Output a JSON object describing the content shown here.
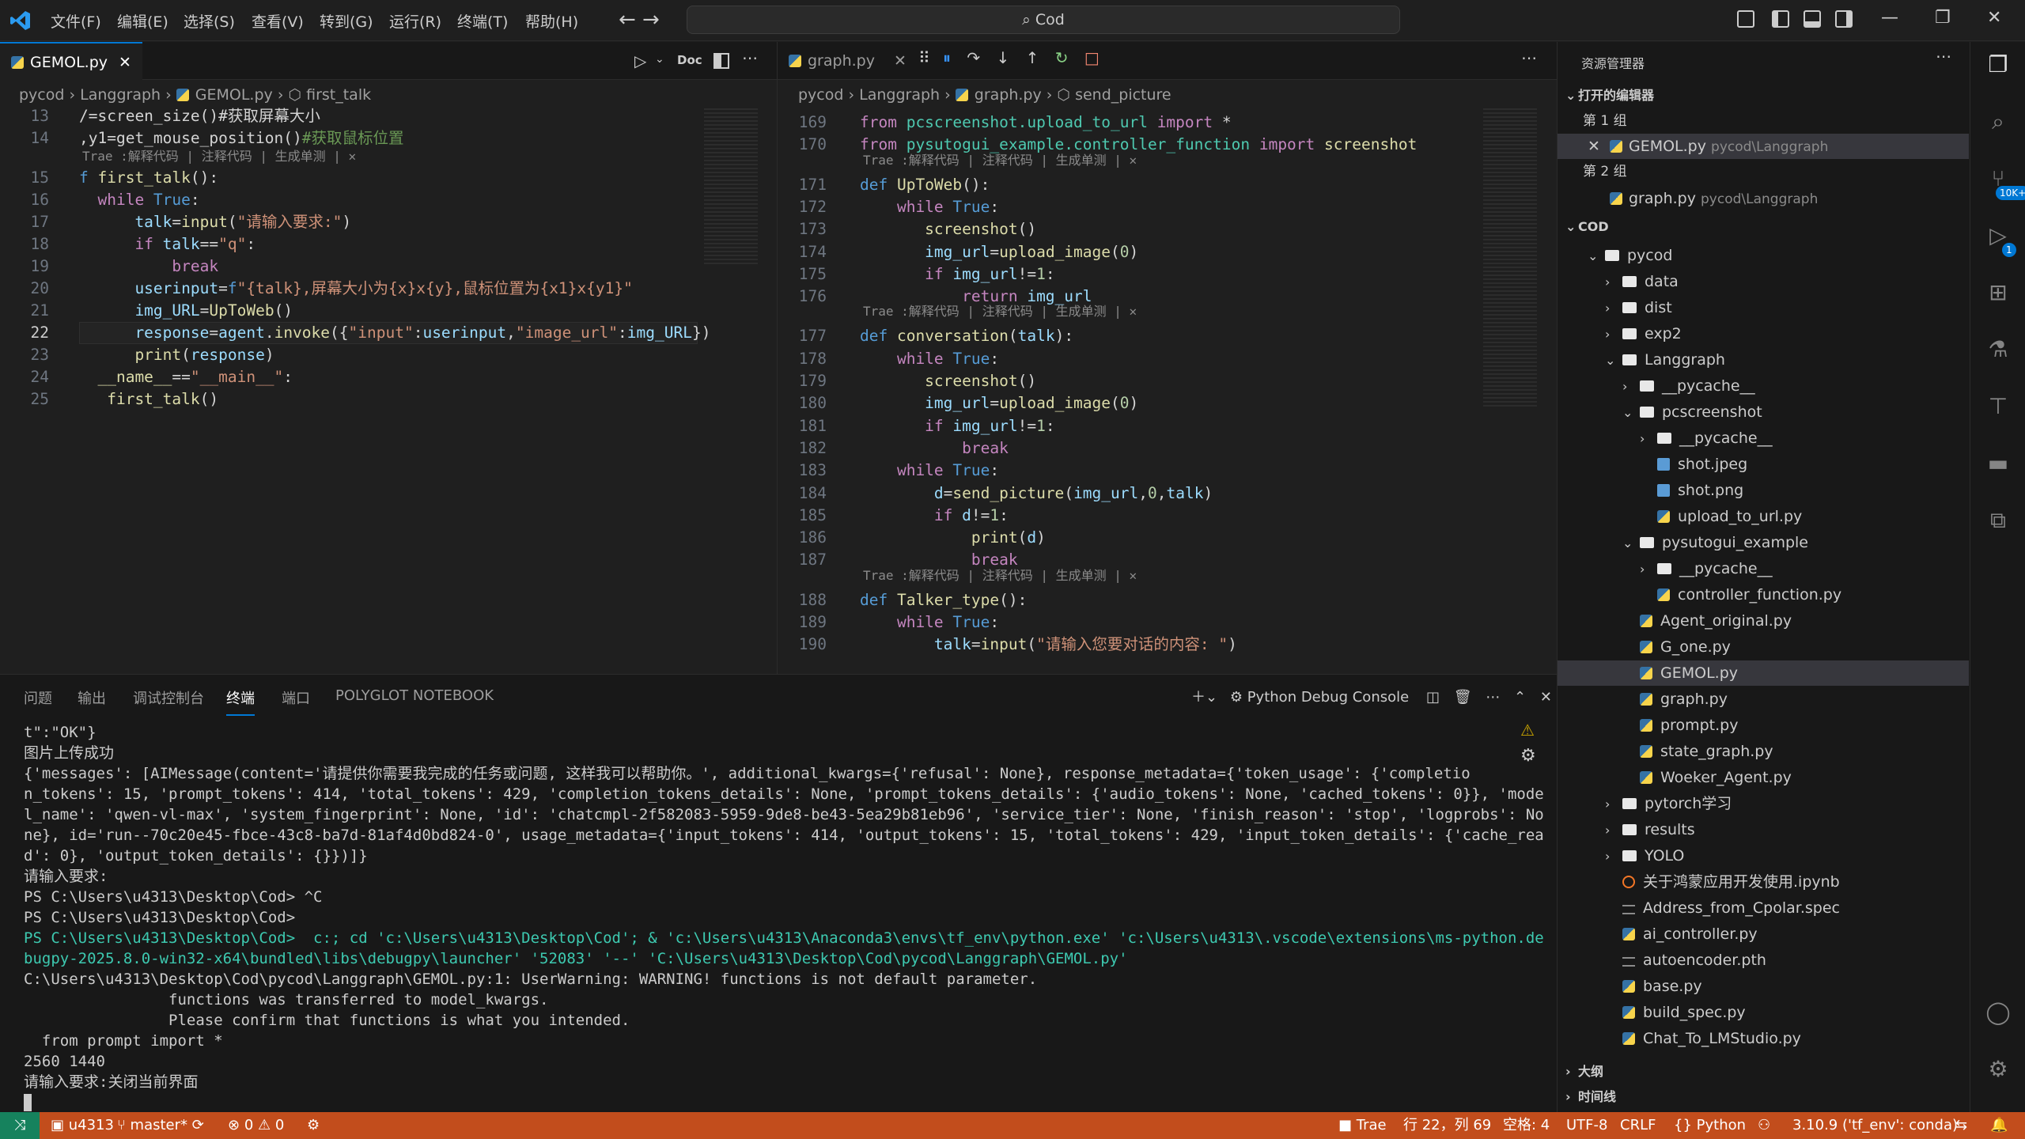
{
  "titlebar": {
    "menus": [
      "文件(F)",
      "编辑(E)",
      "选择(S)",
      "查看(V)",
      "转到(G)",
      "运行(R)",
      "终端(T)",
      "帮助(H)"
    ],
    "search": "Cod",
    "nav": "← →"
  },
  "left_editor": {
    "tab": "GEMOL.py",
    "toolbar": {
      "doc": "Doc"
    },
    "breadcrumb": [
      "pycod",
      "Langgraph",
      "GEMOL.py",
      "first_talk"
    ],
    "lines": [
      {
        "n": "13",
        "parts": [
          [
            "pl",
            "/=screen_size()#获取屏幕大小"
          ]
        ]
      },
      {
        "n": "14",
        "parts": [
          [
            "pl",
            ",y1=get_mouse_position()"
          ],
          [
            "cm",
            "#获取鼠标位置"
          ]
        ]
      },
      {
        "n": "15",
        "parts": [
          [
            "kwb",
            "f "
          ],
          [
            "fn",
            "first_talk"
          ],
          [
            "pl",
            "():"
          ]
        ]
      },
      {
        "n": "16",
        "parts": [
          [
            "kw",
            "  while "
          ],
          [
            "kwb",
            "True"
          ],
          [
            "pl",
            ":"
          ]
        ]
      },
      {
        "n": "17",
        "parts": [
          [
            "nv",
            "      talk"
          ],
          [
            "pl",
            "="
          ],
          [
            "fn",
            "input"
          ],
          [
            "pl",
            "("
          ],
          [
            "st",
            "\"请输入要求:\""
          ],
          [
            "pl",
            ")"
          ]
        ]
      },
      {
        "n": "18",
        "parts": [
          [
            "kw",
            "      if "
          ],
          [
            "nv",
            "talk"
          ],
          [
            "pl",
            "=="
          ],
          [
            "st",
            "\"q\""
          ],
          [
            "pl",
            ":"
          ]
        ]
      },
      {
        "n": "19",
        "parts": [
          [
            "kw",
            "          break"
          ]
        ]
      },
      {
        "n": "20",
        "parts": [
          [
            "nv",
            "      userinput"
          ],
          [
            "pl",
            "="
          ],
          [
            "kwb",
            "f"
          ],
          [
            "st",
            "\"{talk},屏幕大小为{x}x{y},鼠标位置为{x1}x{y1}\""
          ]
        ]
      },
      {
        "n": "21",
        "parts": [
          [
            "nv",
            "      img_URL"
          ],
          [
            "pl",
            "="
          ],
          [
            "fn",
            "UpToWeb"
          ],
          [
            "pl",
            "()"
          ]
        ]
      },
      {
        "n": "22",
        "parts": [
          [
            "nv",
            "      response"
          ],
          [
            "pl",
            "="
          ],
          [
            "nv",
            "agent"
          ],
          [
            "pl",
            "."
          ],
          [
            "fn",
            "invoke"
          ],
          [
            "pl",
            "({"
          ],
          [
            "st",
            "\"input\""
          ],
          [
            "pl",
            ":"
          ],
          [
            "nv",
            "userinput"
          ],
          [
            "pl",
            ","
          ],
          [
            "st",
            "\"image_url\""
          ],
          [
            "pl",
            ":"
          ],
          [
            "nv",
            "img_URL"
          ],
          [
            "pl",
            "})"
          ]
        ]
      },
      {
        "n": "23",
        "parts": [
          [
            "fn",
            "      print"
          ],
          [
            "pl",
            "("
          ],
          [
            "nv",
            "response"
          ],
          [
            "pl",
            ")"
          ]
        ]
      },
      {
        "n": "24",
        "parts": [
          [
            "pl",
            "  "
          ],
          [
            "fn",
            "__name__"
          ],
          [
            "pl",
            "=="
          ],
          [
            "st",
            "\"__main__\""
          ],
          [
            "pl",
            ":"
          ]
        ]
      },
      {
        "n": "25",
        "parts": [
          [
            "fn",
            "   first_talk"
          ],
          [
            "pl",
            "()"
          ]
        ]
      }
    ],
    "hint": "Trae :解释代码 | 注释代码 | 生成单测 | ✕"
  },
  "right_editor": {
    "tab": "graph.py",
    "breadcrumb": [
      "pycod",
      "Langgraph",
      "graph.py",
      "send_picture"
    ],
    "hint": "Trae :解释代码 | 注释代码 | 生成单测 | ✕",
    "lines": [
      {
        "n": "169",
        "parts": [
          [
            "kw",
            "from "
          ],
          [
            "cl",
            "pcscreenshot.upload_to_url"
          ],
          [
            "kw",
            " import "
          ],
          [
            "pl",
            "*"
          ]
        ]
      },
      {
        "n": "170",
        "parts": [
          [
            "kw",
            "from "
          ],
          [
            "cl",
            "pysutogui_example.controller_function"
          ],
          [
            "kw",
            " import "
          ],
          [
            "fn",
            "screenshot"
          ]
        ]
      },
      {
        "n": "171",
        "parts": [
          [
            "kwb",
            "def "
          ],
          [
            "fn",
            "UpToWeb"
          ],
          [
            "pl",
            "():"
          ]
        ]
      },
      {
        "n": "172",
        "parts": [
          [
            "kw",
            "    while "
          ],
          [
            "kwb",
            "True"
          ],
          [
            "pl",
            ":"
          ]
        ]
      },
      {
        "n": "173",
        "parts": [
          [
            "fn",
            "       screenshot"
          ],
          [
            "pl",
            "()"
          ]
        ]
      },
      {
        "n": "174",
        "parts": [
          [
            "nv",
            "       img_url"
          ],
          [
            "pl",
            "="
          ],
          [
            "fn",
            "upload_image"
          ],
          [
            "pl",
            "("
          ],
          [
            "nu",
            "0"
          ],
          [
            "pl",
            ")"
          ]
        ]
      },
      {
        "n": "175",
        "parts": [
          [
            "kw",
            "       if "
          ],
          [
            "nv",
            "img_url"
          ],
          [
            "pl",
            "!="
          ],
          [
            "nu",
            "1"
          ],
          [
            "pl",
            ":"
          ]
        ]
      },
      {
        "n": "176",
        "parts": [
          [
            "kw",
            "           return "
          ],
          [
            "nv",
            "img_url"
          ]
        ]
      },
      {
        "n": "177",
        "parts": [
          [
            "kwb",
            "def "
          ],
          [
            "fn",
            "conversation"
          ],
          [
            "pl",
            "("
          ],
          [
            "nv",
            "talk"
          ],
          [
            "pl",
            "):"
          ]
        ]
      },
      {
        "n": "178",
        "parts": [
          [
            "kw",
            "    while "
          ],
          [
            "kwb",
            "True"
          ],
          [
            "pl",
            ":"
          ]
        ]
      },
      {
        "n": "179",
        "parts": [
          [
            "fn",
            "       screenshot"
          ],
          [
            "pl",
            "()"
          ]
        ]
      },
      {
        "n": "180",
        "parts": [
          [
            "nv",
            "       img_url"
          ],
          [
            "pl",
            "="
          ],
          [
            "fn",
            "upload_image"
          ],
          [
            "pl",
            "("
          ],
          [
            "nu",
            "0"
          ],
          [
            "pl",
            ")"
          ]
        ]
      },
      {
        "n": "181",
        "parts": [
          [
            "kw",
            "       if "
          ],
          [
            "nv",
            "img_url"
          ],
          [
            "pl",
            "!="
          ],
          [
            "nu",
            "1"
          ],
          [
            "pl",
            ":"
          ]
        ]
      },
      {
        "n": "182",
        "parts": [
          [
            "kw",
            "           break"
          ]
        ]
      },
      {
        "n": "183",
        "parts": [
          [
            "kw",
            "    while "
          ],
          [
            "kwb",
            "True"
          ],
          [
            "pl",
            ":"
          ]
        ]
      },
      {
        "n": "184",
        "parts": [
          [
            "nv",
            "        d"
          ],
          [
            "pl",
            "="
          ],
          [
            "fn",
            "send_picture"
          ],
          [
            "pl",
            "("
          ],
          [
            "nv",
            "img_url"
          ],
          [
            "pl",
            ","
          ],
          [
            "nu",
            "0"
          ],
          [
            "pl",
            ","
          ],
          [
            "nv",
            "talk"
          ],
          [
            "pl",
            ")"
          ]
        ]
      },
      {
        "n": "185",
        "parts": [
          [
            "kw",
            "        if "
          ],
          [
            "nv",
            "d"
          ],
          [
            "pl",
            "!="
          ],
          [
            "nu",
            "1"
          ],
          [
            "pl",
            ":"
          ]
        ]
      },
      {
        "n": "186",
        "parts": [
          [
            "fn",
            "            print"
          ],
          [
            "pl",
            "("
          ],
          [
            "nv",
            "d"
          ],
          [
            "pl",
            ")"
          ]
        ]
      },
      {
        "n": "187",
        "parts": [
          [
            "kw",
            "            break"
          ]
        ]
      },
      {
        "n": "188",
        "parts": [
          [
            "kwb",
            "def "
          ],
          [
            "fn",
            "Talker_type"
          ],
          [
            "pl",
            "():"
          ]
        ]
      },
      {
        "n": "189",
        "parts": [
          [
            "kw",
            "    while "
          ],
          [
            "kwb",
            "True"
          ],
          [
            "pl",
            ":"
          ]
        ]
      },
      {
        "n": "190",
        "parts": [
          [
            "nv",
            "        talk"
          ],
          [
            "pl",
            "="
          ],
          [
            "fn",
            "input"
          ],
          [
            "pl",
            "("
          ],
          [
            "st",
            "\"请输入您要对话的内容: \""
          ],
          [
            "pl",
            ")"
          ]
        ]
      }
    ]
  },
  "panel": {
    "tabs": [
      "问题",
      "输出",
      "调试控制台",
      "终端",
      "端口",
      "POLYGLOT NOTEBOOK"
    ],
    "active_tab": "终端",
    "debug_label": "Python Debug Console",
    "terminal": [
      "t\":\"OK\"}",
      "图片上传成功",
      "{'messages': [AIMessage(content='请提供你需要我完成的任务或问题, 这样我可以帮助你。', additional_kwargs={'refusal': None}, response_metadata={'token_usage': {'completio",
      "n_tokens': 15, 'prompt_tokens': 414, 'total_tokens': 429, 'completion_tokens_details': None, 'prompt_tokens_details': {'audio_tokens': None, 'cached_tokens': 0}}, 'mode",
      "l_name': 'qwen-vl-max', 'system_fingerprint': None, 'id': 'chatcmpl-2f582083-5959-9de8-be43-5ea29b81eb96', 'service_tier': None, 'finish_reason': 'stop', 'logprobs': No",
      "ne}, id='run--70c20e45-fbce-43c8-ba7d-81af4d0bd824-0', usage_metadata={'input_tokens': 414, 'output_tokens': 15, 'total_tokens': 429, 'input_token_details': {'cache_rea",
      "d': 0}, 'output_token_details': {}})]}",
      "请输入要求:",
      "PS C:\\Users\\u4313\\Desktop\\Cod> ^C",
      "PS C:\\Users\\u4313\\Desktop\\Cod>",
      "PS C:\\Users\\u4313\\Desktop\\Cod>  c:; cd 'c:\\Users\\u4313\\Desktop\\Cod'; & 'c:\\Users\\u4313\\Anaconda3\\envs\\tf_env\\python.exe' 'c:\\Users\\u4313\\.vscode\\extensions\\ms-python.de",
      "bugpy-2025.8.0-win32-x64\\bundled\\libs\\debugpy\\launcher' '52083' '--' 'C:\\Users\\u4313\\Desktop\\Cod\\pycod\\Langgraph\\GEMOL.py'",
      "C:\\Users\\u4313\\Desktop\\Cod\\pycod\\Langgraph\\GEMOL.py:1: UserWarning: WARNING! functions is not default parameter.",
      "                functions was transferred to model_kwargs.",
      "                Please confirm that functions is what you intended.",
      "  from prompt import *",
      "2560 1440",
      "请输入要求:关闭当前界面"
    ]
  },
  "explorer": {
    "title": "资源管理器",
    "open_editors": "打开的编辑器",
    "group1": "第 1 组",
    "group1_file": "GEMOL.py",
    "group1_path": "pycod\\Langgraph",
    "group2": "第 2 组",
    "group2_file": "graph.py",
    "group2_path": "pycod\\Langgraph",
    "root": "COD",
    "tree": [
      {
        "d": 1,
        "t": "folder",
        "open": true,
        "name": "pycod"
      },
      {
        "d": 2,
        "t": "folder",
        "open": false,
        "name": "data"
      },
      {
        "d": 2,
        "t": "folder",
        "open": false,
        "name": "dist"
      },
      {
        "d": 2,
        "t": "folder",
        "open": false,
        "name": "exp2"
      },
      {
        "d": 2,
        "t": "folder",
        "open": true,
        "name": "Langgraph"
      },
      {
        "d": 3,
        "t": "folder",
        "open": false,
        "name": "__pycache__"
      },
      {
        "d": 3,
        "t": "folder",
        "open": true,
        "name": "pcscreenshot"
      },
      {
        "d": 4,
        "t": "folder",
        "open": false,
        "name": "__pycache__"
      },
      {
        "d": 4,
        "t": "img",
        "name": "shot.jpeg"
      },
      {
        "d": 4,
        "t": "img",
        "name": "shot.png"
      },
      {
        "d": 4,
        "t": "py",
        "name": "upload_to_url.py"
      },
      {
        "d": 3,
        "t": "folder",
        "open": true,
        "name": "pysutogui_example"
      },
      {
        "d": 4,
        "t": "folder",
        "open": false,
        "name": "__pycache__"
      },
      {
        "d": 4,
        "t": "py",
        "name": "controller_function.py"
      },
      {
        "d": 3,
        "t": "py",
        "name": "Agent_original.py"
      },
      {
        "d": 3,
        "t": "py",
        "name": "G_one.py"
      },
      {
        "d": 3,
        "t": "py",
        "name": "GEMOL.py",
        "sel": true
      },
      {
        "d": 3,
        "t": "py",
        "name": "graph.py"
      },
      {
        "d": 3,
        "t": "py",
        "name": "prompt.py"
      },
      {
        "d": 3,
        "t": "py",
        "name": "state_graph.py"
      },
      {
        "d": 3,
        "t": "py",
        "name": "Woeker_Agent.py"
      },
      {
        "d": 2,
        "t": "folder",
        "open": false,
        "name": "pytorch学习"
      },
      {
        "d": 2,
        "t": "folder",
        "open": false,
        "name": "results"
      },
      {
        "d": 2,
        "t": "folder",
        "open": false,
        "name": "YOLO"
      },
      {
        "d": 2,
        "t": "nb",
        "name": "关于鸿蒙应用开发使用.ipynb"
      },
      {
        "d": 2,
        "t": "txt",
        "name": "Address_from_Cpolar.spec"
      },
      {
        "d": 2,
        "t": "py",
        "name": "ai_controller.py"
      },
      {
        "d": 2,
        "t": "txt",
        "name": "autoencoder.pth"
      },
      {
        "d": 2,
        "t": "py",
        "name": "base.py"
      },
      {
        "d": 2,
        "t": "py",
        "name": "build_spec.py"
      },
      {
        "d": 2,
        "t": "py",
        "name": "Chat_To_LMStudio.py"
      }
    ],
    "outline": "大纲",
    "timeline": "时间线"
  },
  "activity": {
    "badge1": "10K+",
    "badge2": "1"
  },
  "statusbar": {
    "user": "u4313",
    "branch": "master*",
    "errors": "0",
    "warnings": "0",
    "trae": "Trae",
    "position": "行 22，列 69",
    "spaces": "空格: 4",
    "encoding": "UTF-8",
    "eol": "CRLF",
    "lang": "Python",
    "interpreter": "3.10.9 ('tf_env': conda)"
  }
}
